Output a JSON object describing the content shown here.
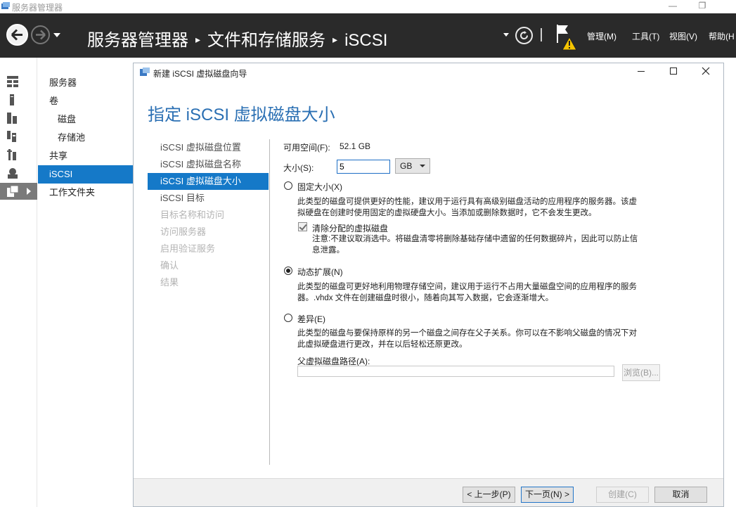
{
  "window": {
    "title": "服务器管理器",
    "min_glyph": "—",
    "max_glyph": "❐"
  },
  "header": {
    "breadcrumb": [
      "服务器管理器",
      "文件和存储服务",
      "iSCSI"
    ],
    "breadcrumb_sep": "▸",
    "menus": [
      {
        "label": "管理(M)"
      },
      {
        "label": "工具(T)"
      },
      {
        "label": "视图(V)"
      },
      {
        "label": "帮助(H"
      }
    ]
  },
  "icon_strip": [
    {
      "icon": "dashboard-icon"
    },
    {
      "icon": "local-server-icon"
    },
    {
      "icon": "all-servers-icon"
    },
    {
      "icon": "role-icon"
    },
    {
      "icon": "tools-icon"
    },
    {
      "icon": "storage-icon"
    },
    {
      "icon": "file-storage-icon",
      "active": true
    }
  ],
  "nav": {
    "items": [
      {
        "label": "服务器",
        "indent": 1
      },
      {
        "label": "卷",
        "indent": 1
      },
      {
        "label": "磁盘",
        "indent": 2
      },
      {
        "label": "存储池",
        "indent": 2
      },
      {
        "label": "共享",
        "indent": 1
      },
      {
        "label": "iSCSI",
        "indent": 1,
        "active": true
      },
      {
        "label": "工作文件夹",
        "indent": 1
      }
    ]
  },
  "wizard": {
    "title": "新建 iSCSI 虚拟磁盘向导",
    "heading": "指定 iSCSI 虚拟磁盘大小",
    "steps": [
      {
        "label": "iSCSI 虚拟磁盘位置",
        "state": "done"
      },
      {
        "label": "iSCSI 虚拟磁盘名称",
        "state": "done"
      },
      {
        "label": "iSCSI 虚拟磁盘大小",
        "state": "active"
      },
      {
        "label": "iSCSI 目标",
        "state": "done"
      },
      {
        "label": "目标名称和访问",
        "state": "disabled"
      },
      {
        "label": "访问服务器",
        "state": "disabled"
      },
      {
        "label": "启用验证服务",
        "state": "disabled"
      },
      {
        "label": "确认",
        "state": "disabled"
      },
      {
        "label": "结果",
        "state": "disabled"
      }
    ],
    "available_label": "可用空间(F):",
    "available_value": "52.1 GB",
    "size_label": "大小(S):",
    "size_value": "5",
    "size_unit": "GB",
    "options": {
      "fixed": {
        "label": "固定大小(X)",
        "selected": false,
        "desc_line1": "此类型的磁盘可提供更好的性能，建议用于运行具有高级别磁盘活动的应用程序的服务器。该虚",
        "desc_line2": "拟硬盘在创建时使用固定的虚拟硬盘大小。当添加或删除数据时，它不会发生更改。",
        "clear_label": "清除分配的虚拟磁盘",
        "clear_checked": true,
        "note_line1": "注意:不建议取消选中。将磁盘清零将删除基础存储中遗留的任何数据碎片，因此可以防止信",
        "note_line2": "息泄露。"
      },
      "dynamic": {
        "label": "动态扩展(N)",
        "selected": true,
        "desc_line1": "此类型的磁盘可更好地利用物理存储空间，建议用于运行不占用大量磁盘空间的应用程序的服务",
        "desc_line2": "器。.vhdx 文件在创建磁盘时很小，随着向其写入数据，它会逐渐增大。"
      },
      "differencing": {
        "label": "差异(E)",
        "selected": false,
        "desc_line1": "此类型的磁盘与要保持原样的另一个磁盘之间存在父子关系。你可以在不影响父磁盘的情况下对",
        "desc_line2": "此虚拟硬盘进行更改，并在以后轻松还原更改。",
        "parent_path_label": "父虚拟磁盘路径(A):",
        "parent_path_value": "",
        "browse_label": "浏览(B)..."
      }
    },
    "buttons": {
      "prev": "< 上一步(P)",
      "next": "下一页(N) >",
      "create": "创建(C)",
      "cancel": "取消"
    },
    "colors": {
      "accent": "#1579c8",
      "heading": "#2a6fb3",
      "header_bg": "#2a2a2a"
    }
  }
}
